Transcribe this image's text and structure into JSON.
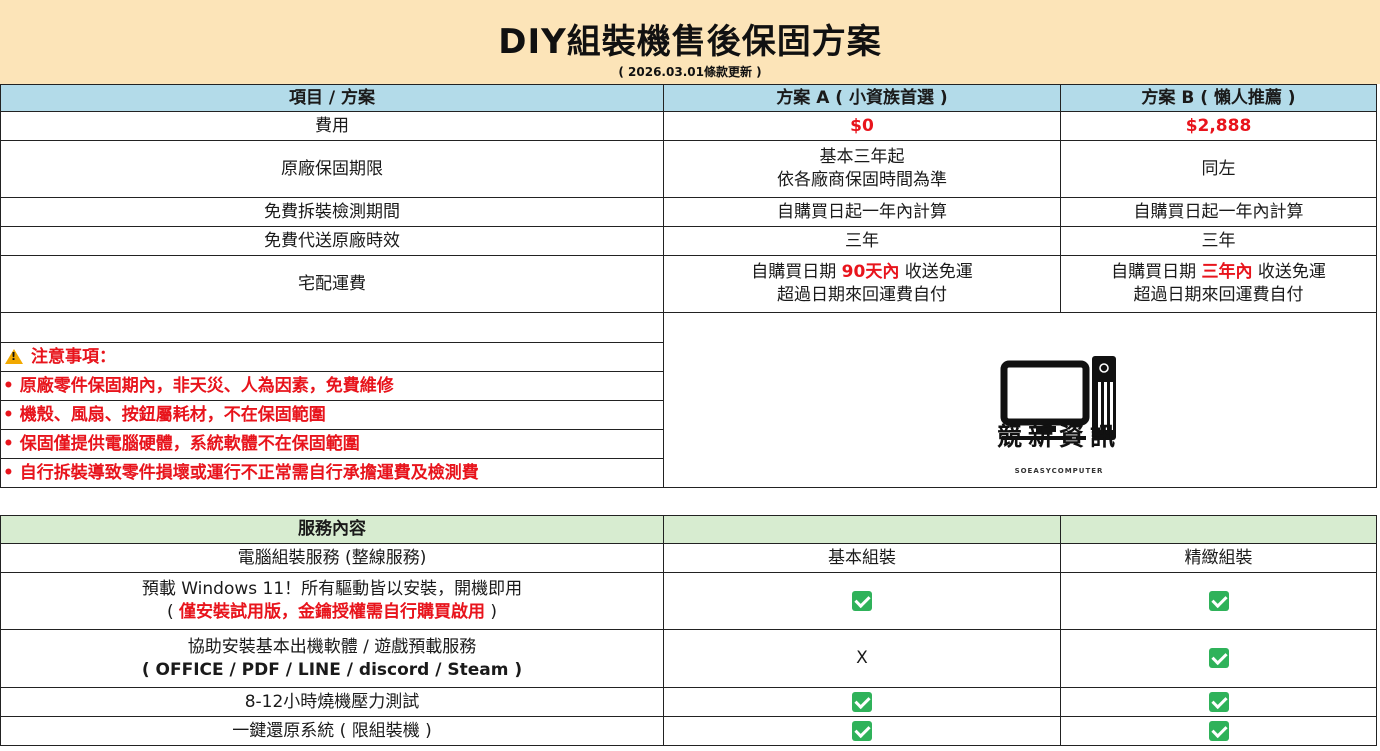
{
  "header": {
    "title": "DIY組裝機售後保固方案",
    "subtitle": "( 2026.03.01條款更新 )"
  },
  "plans": {
    "columns": [
      "項目 / 方案",
      "方案 A ( 小資族首選 )",
      "方案 B ( 懶人推薦 )"
    ],
    "rows": [
      {
        "label": "費用",
        "a": "$0",
        "b": "$2,888"
      },
      {
        "label": "原廠保固期限",
        "a1": "基本三年起",
        "a2": "依各廠商保固時間為準",
        "b": "同左"
      },
      {
        "label": "免費拆裝檢測期間",
        "a": "自購買日起一年內計算",
        "b": "自購買日起一年內計算"
      },
      {
        "label": "免費代送原廠時效",
        "a": "三年",
        "b": "三年"
      },
      {
        "label": "宅配運費",
        "a_pre": "自購買日期 ",
        "a_hl": "90天內",
        "a_post": " 收送免運",
        "a2": "超過日期來回運費自付",
        "b_pre": "自購買日期 ",
        "b_hl": "三年內",
        "b_post": " 收送免運",
        "b2": "超過日期來回運費自付"
      }
    ]
  },
  "notes": {
    "title": "注意事項：",
    "items": [
      "• 原廠零件保固期內，非天災、人為因素，免費維修",
      "• 機殼、風扇、按鈕屬耗材，不在保固範圍",
      "• 保固僅提供電腦硬體，系統軟體不在保固範圍",
      "• 自行拆裝導致零件損壞或運行不正常需自行承擔運費及檢測費"
    ]
  },
  "logo": {
    "name": "競新資訊",
    "tagline": "SOEASYCOMPUTER"
  },
  "services": {
    "header": "服務內容",
    "rows": [
      {
        "label": "電腦組裝服務 (整線服務)",
        "a": "基本組裝",
        "b": "精緻組裝"
      },
      {
        "label1": "預載 Windows 11！所有驅動皆以安裝，開機即用",
        "label2_pre": "( ",
        "label2_hl": "僅安裝試用版，金鑰授權需自行購買啟用",
        "label2_post": " )",
        "a": "check",
        "b": "check"
      },
      {
        "label1": "協助安裝基本出機軟體 / 遊戲預載服務",
        "label2": "( OFFICE / PDF / LINE / discord / Steam )",
        "a": "X",
        "b": "check"
      },
      {
        "label": "8-12小時燒機壓力測試",
        "a": "check",
        "b": "check"
      },
      {
        "label": "一鍵還原系統 ( 限組裝機 )",
        "a": "check",
        "b": "check"
      }
    ]
  },
  "colors": {
    "title_band": "#fce4b8",
    "plan_header": "#b3dbe9",
    "service_header": "#d7ecd0",
    "highlight_red": "#e8141c",
    "check_green": "#2fb25a"
  }
}
